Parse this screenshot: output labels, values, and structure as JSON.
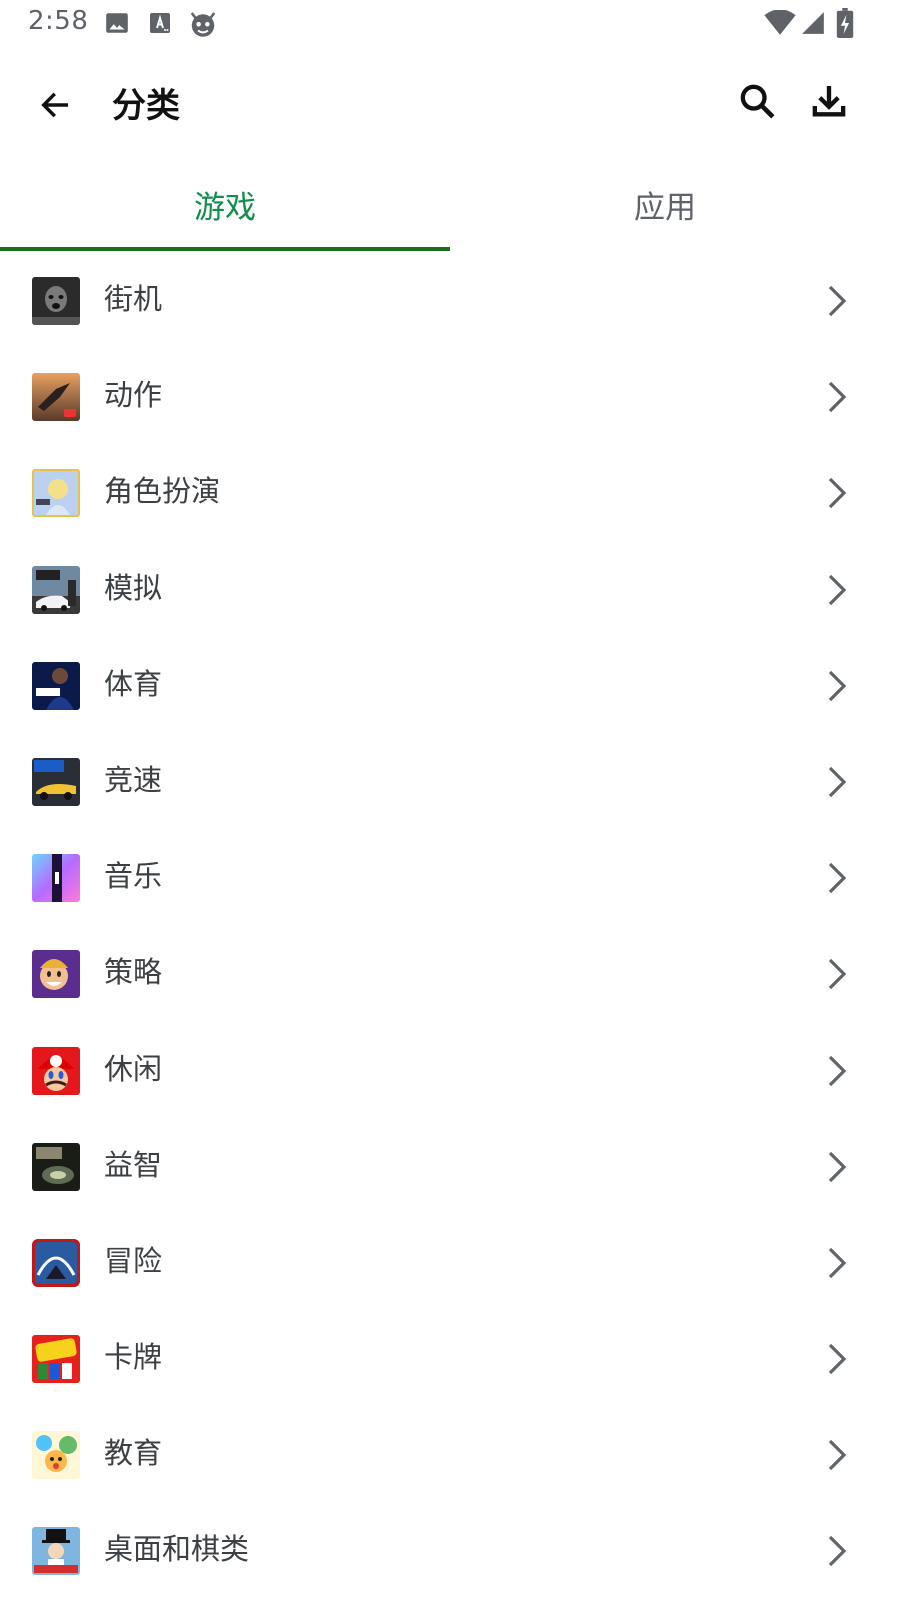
{
  "status_bar": {
    "time": "2:58",
    "left_icons": [
      "image-icon",
      "font-download-icon",
      "android-head-icon"
    ],
    "right_icons": [
      "wifi-icon",
      "signal-icon",
      "battery-charging-icon"
    ]
  },
  "app_bar": {
    "title": "分类",
    "back_icon": "arrow-left-icon",
    "search_icon": "search-icon",
    "download_icon": "download-icon"
  },
  "tabs": [
    {
      "label": "游戏",
      "active": true
    },
    {
      "label": "应用",
      "active": false
    }
  ],
  "colors": {
    "accent_text": "#0f8f4a",
    "indicator": "#1a6e1a",
    "label": "#3c4043",
    "chevron": "#5f6368"
  },
  "categories": [
    {
      "label": "街机",
      "icon": "arcade-game-thumbnail"
    },
    {
      "label": "动作",
      "icon": "action-game-thumbnail"
    },
    {
      "label": "角色扮演",
      "icon": "rpg-game-thumbnail"
    },
    {
      "label": "模拟",
      "icon": "simulation-game-thumbnail"
    },
    {
      "label": "体育",
      "icon": "sports-game-thumbnail"
    },
    {
      "label": "竞速",
      "icon": "racing-game-thumbnail"
    },
    {
      "label": "音乐",
      "icon": "music-game-thumbnail"
    },
    {
      "label": "策略",
      "icon": "strategy-game-thumbnail"
    },
    {
      "label": "休闲",
      "icon": "casual-game-thumbnail"
    },
    {
      "label": "益智",
      "icon": "puzzle-game-thumbnail"
    },
    {
      "label": "冒险",
      "icon": "adventure-game-thumbnail"
    },
    {
      "label": "卡牌",
      "icon": "card-game-thumbnail"
    },
    {
      "label": "教育",
      "icon": "education-game-thumbnail"
    },
    {
      "label": "桌面和棋类",
      "icon": "board-game-thumbnail"
    }
  ]
}
